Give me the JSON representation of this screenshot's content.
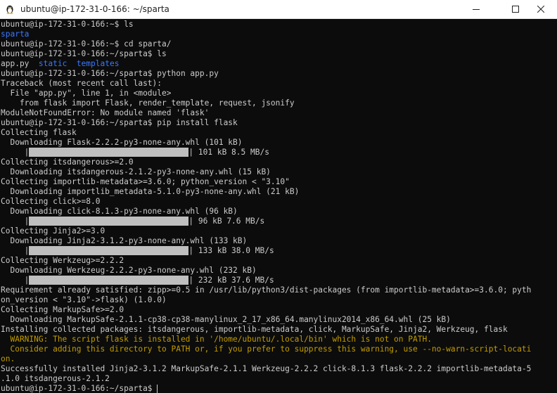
{
  "window": {
    "title": "ubuntu@ip-172-31-0-166: ~/sparta",
    "app_icon": "tux-penguin-icon",
    "controls": [
      "minimize-icon",
      "maximize-icon",
      "close-icon"
    ]
  },
  "colors": {
    "background": "#0c0c0c",
    "text": "#cccccc",
    "directory": "#3b78ff",
    "warning": "#c19c00",
    "progress_fill": "#bfbfbf"
  },
  "terminal": {
    "lines": [
      {
        "type": "text",
        "text": "ubuntu@ip-172-31-0-166:~$ ls"
      },
      {
        "type": "blue",
        "text": "sparta"
      },
      {
        "type": "text",
        "text": "ubuntu@ip-172-31-0-166:~$ cd sparta/"
      },
      {
        "type": "text",
        "text": "ubuntu@ip-172-31-0-166:~/sparta$ ls"
      },
      {
        "type": "ls",
        "file": "app.py",
        "dirs": [
          "static",
          "templates"
        ]
      },
      {
        "type": "text",
        "text": "ubuntu@ip-172-31-0-166:~/sparta$ python app.py"
      },
      {
        "type": "text",
        "text": "Traceback (most recent call last):"
      },
      {
        "type": "text",
        "text": "  File \"app.py\", line 1, in <module>"
      },
      {
        "type": "text",
        "text": "    from flask import Flask, render_template, request, jsonify"
      },
      {
        "type": "text",
        "text": "ModuleNotFoundError: No module named 'flask'"
      },
      {
        "type": "text",
        "text": "ubuntu@ip-172-31-0-166:~/sparta$ pip install flask"
      },
      {
        "type": "text",
        "text": "Collecting flask"
      },
      {
        "type": "text",
        "text": "  Downloading Flask-2.2.2-py3-none-any.whl (101 kB)"
      },
      {
        "type": "progress",
        "text": " 101 kB 8.5 MB/s",
        "fraction": 1.0
      },
      {
        "type": "text",
        "text": "Collecting itsdangerous>=2.0"
      },
      {
        "type": "text",
        "text": "  Downloading itsdangerous-2.1.2-py3-none-any.whl (15 kB)"
      },
      {
        "type": "text",
        "text": "Collecting importlib-metadata>=3.6.0; python_version < \"3.10\""
      },
      {
        "type": "text",
        "text": "  Downloading importlib_metadata-5.1.0-py3-none-any.whl (21 kB)"
      },
      {
        "type": "text",
        "text": "Collecting click>=8.0"
      },
      {
        "type": "text",
        "text": "  Downloading click-8.1.3-py3-none-any.whl (96 kB)"
      },
      {
        "type": "progress",
        "text": " 96 kB 7.6 MB/s",
        "fraction": 1.0
      },
      {
        "type": "text",
        "text": "Collecting Jinja2>=3.0"
      },
      {
        "type": "text",
        "text": "  Downloading Jinja2-3.1.2-py3-none-any.whl (133 kB)"
      },
      {
        "type": "progress",
        "text": " 133 kB 38.0 MB/s",
        "fraction": 1.0
      },
      {
        "type": "text",
        "text": "Collecting Werkzeug>=2.2.2"
      },
      {
        "type": "text",
        "text": "  Downloading Werkzeug-2.2.2-py3-none-any.whl (232 kB)"
      },
      {
        "type": "progress",
        "text": " 232 kB 37.6 MB/s",
        "fraction": 1.0
      },
      {
        "type": "text",
        "text": "Requirement already satisfied: zipp>=0.5 in /usr/lib/python3/dist-packages (from importlib-metadata>=3.6.0; pyth"
      },
      {
        "type": "text",
        "text": "on_version < \"3.10\"->flask) (1.0.0)"
      },
      {
        "type": "text",
        "text": "Collecting MarkupSafe>=2.0"
      },
      {
        "type": "text",
        "text": "  Downloading MarkupSafe-2.1.1-cp38-cp38-manylinux_2_17_x86_64.manylinux2014_x86_64.whl (25 kB)"
      },
      {
        "type": "text",
        "text": "Installing collected packages: itsdangerous, importlib-metadata, click, MarkupSafe, Jinja2, Werkzeug, flask"
      },
      {
        "type": "yellow",
        "text": "  WARNING: The script flask is installed in '/home/ubuntu/.local/bin' which is not on PATH."
      },
      {
        "type": "yellow",
        "text": "  Consider adding this directory to PATH or, if you prefer to suppress this warning, use --no-warn-script-locati"
      },
      {
        "type": "yellow",
        "text": "on."
      },
      {
        "type": "text",
        "text": "Successfully installed Jinja2-3.1.2 MarkupSafe-2.1.1 Werkzeug-2.2.2 click-8.1.3 flask-2.2.2 importlib-metadata-5"
      },
      {
        "type": "text",
        "text": ".1.0 itsdangerous-2.1.2"
      },
      {
        "type": "prompt",
        "text": "ubuntu@ip-172-31-0-166:~/sparta$ "
      }
    ]
  }
}
